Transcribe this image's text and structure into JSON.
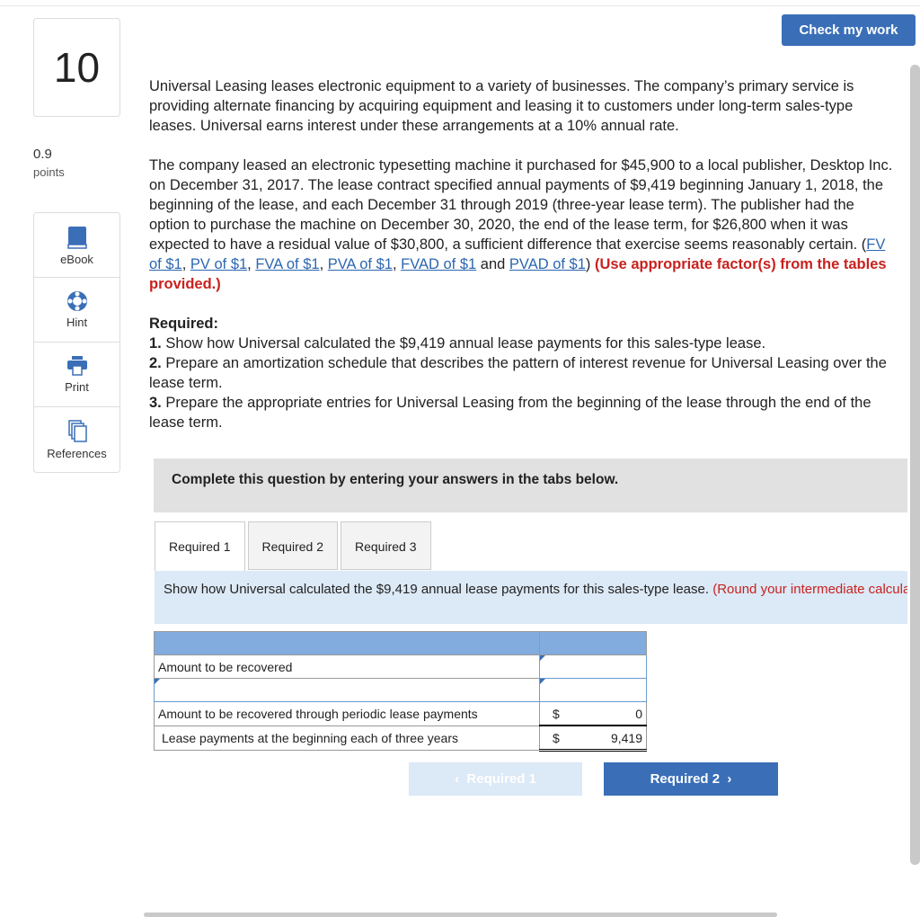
{
  "header": {
    "check_label": "Check my work"
  },
  "question": {
    "number": "10",
    "points": "0.9",
    "points_label": "points"
  },
  "tools": [
    {
      "label": "eBook",
      "icon": "book-icon"
    },
    {
      "label": "Hint",
      "icon": "lifebuoy-icon"
    },
    {
      "label": "Print",
      "icon": "printer-icon"
    },
    {
      "label": "References",
      "icon": "copy-icon"
    }
  ],
  "body": {
    "p1": "Universal Leasing leases electronic equipment to a variety of businesses. The company’s primary service is providing alternate financing by acquiring equipment and leasing it to customers under long-term sales-type leases. Universal earns interest under these arrangements at a 10% annual rate.",
    "p2": "The company leased an electronic typesetting machine it purchased for $45,900 to a local publisher, Desktop Inc. on December 31, 2017. The lease contract specified annual payments of $9,419 beginning January 1, 2018, the beginning of the lease, and each December 31 through 2019 (three-year lease term). The publisher had the option to purchase the machine on December 30, 2020, the end of the lease term, for $26,800 when it was expected to have a residual value of $30,800, a sufficient difference that exercise seems reasonably certain. (",
    "links": [
      "FV of $1",
      "PV of $1",
      "FVA of $1",
      "PVA of $1",
      "FVAD of $1",
      "PVAD of $1"
    ],
    "and": "and",
    "instruction": "(Use appropriate factor(s) from the tables provided.)",
    "required_title": "Required:",
    "req": [
      {
        "n": "1.",
        "t": "Show how Universal calculated the $9,419 annual lease payments for this sales-type lease."
      },
      {
        "n": "2.",
        "t": "Prepare an amortization schedule that describes the pattern of interest revenue for Universal Leasing over the lease term."
      },
      {
        "n": "3.",
        "t": "Prepare the appropriate entries for Universal Leasing from the beginning of the lease through the end of the lease term."
      }
    ]
  },
  "banner": "Complete this question by entering your answers in the tabs below.",
  "tabs": [
    "Required 1",
    "Required 2",
    "Required 3"
  ],
  "instr": {
    "text": "Show how Universal calculated the $9,419 annual lease payments for this sales-type lease.",
    "note": "(Round your intermediate calculations and final answers to the nearest whole dollar amount.)"
  },
  "table": {
    "rows": [
      {
        "label": "Amount to be recovered",
        "value": ""
      },
      {
        "label": "",
        "value": ""
      },
      {
        "label": "Amount to be recovered through periodic lease payments",
        "cur": "$",
        "value": "0"
      },
      {
        "label": "Lease payments at the beginning each of three years",
        "cur": "$",
        "value": "9,419"
      }
    ]
  },
  "nav": {
    "prev": "Required 1",
    "next": "Required 2"
  }
}
